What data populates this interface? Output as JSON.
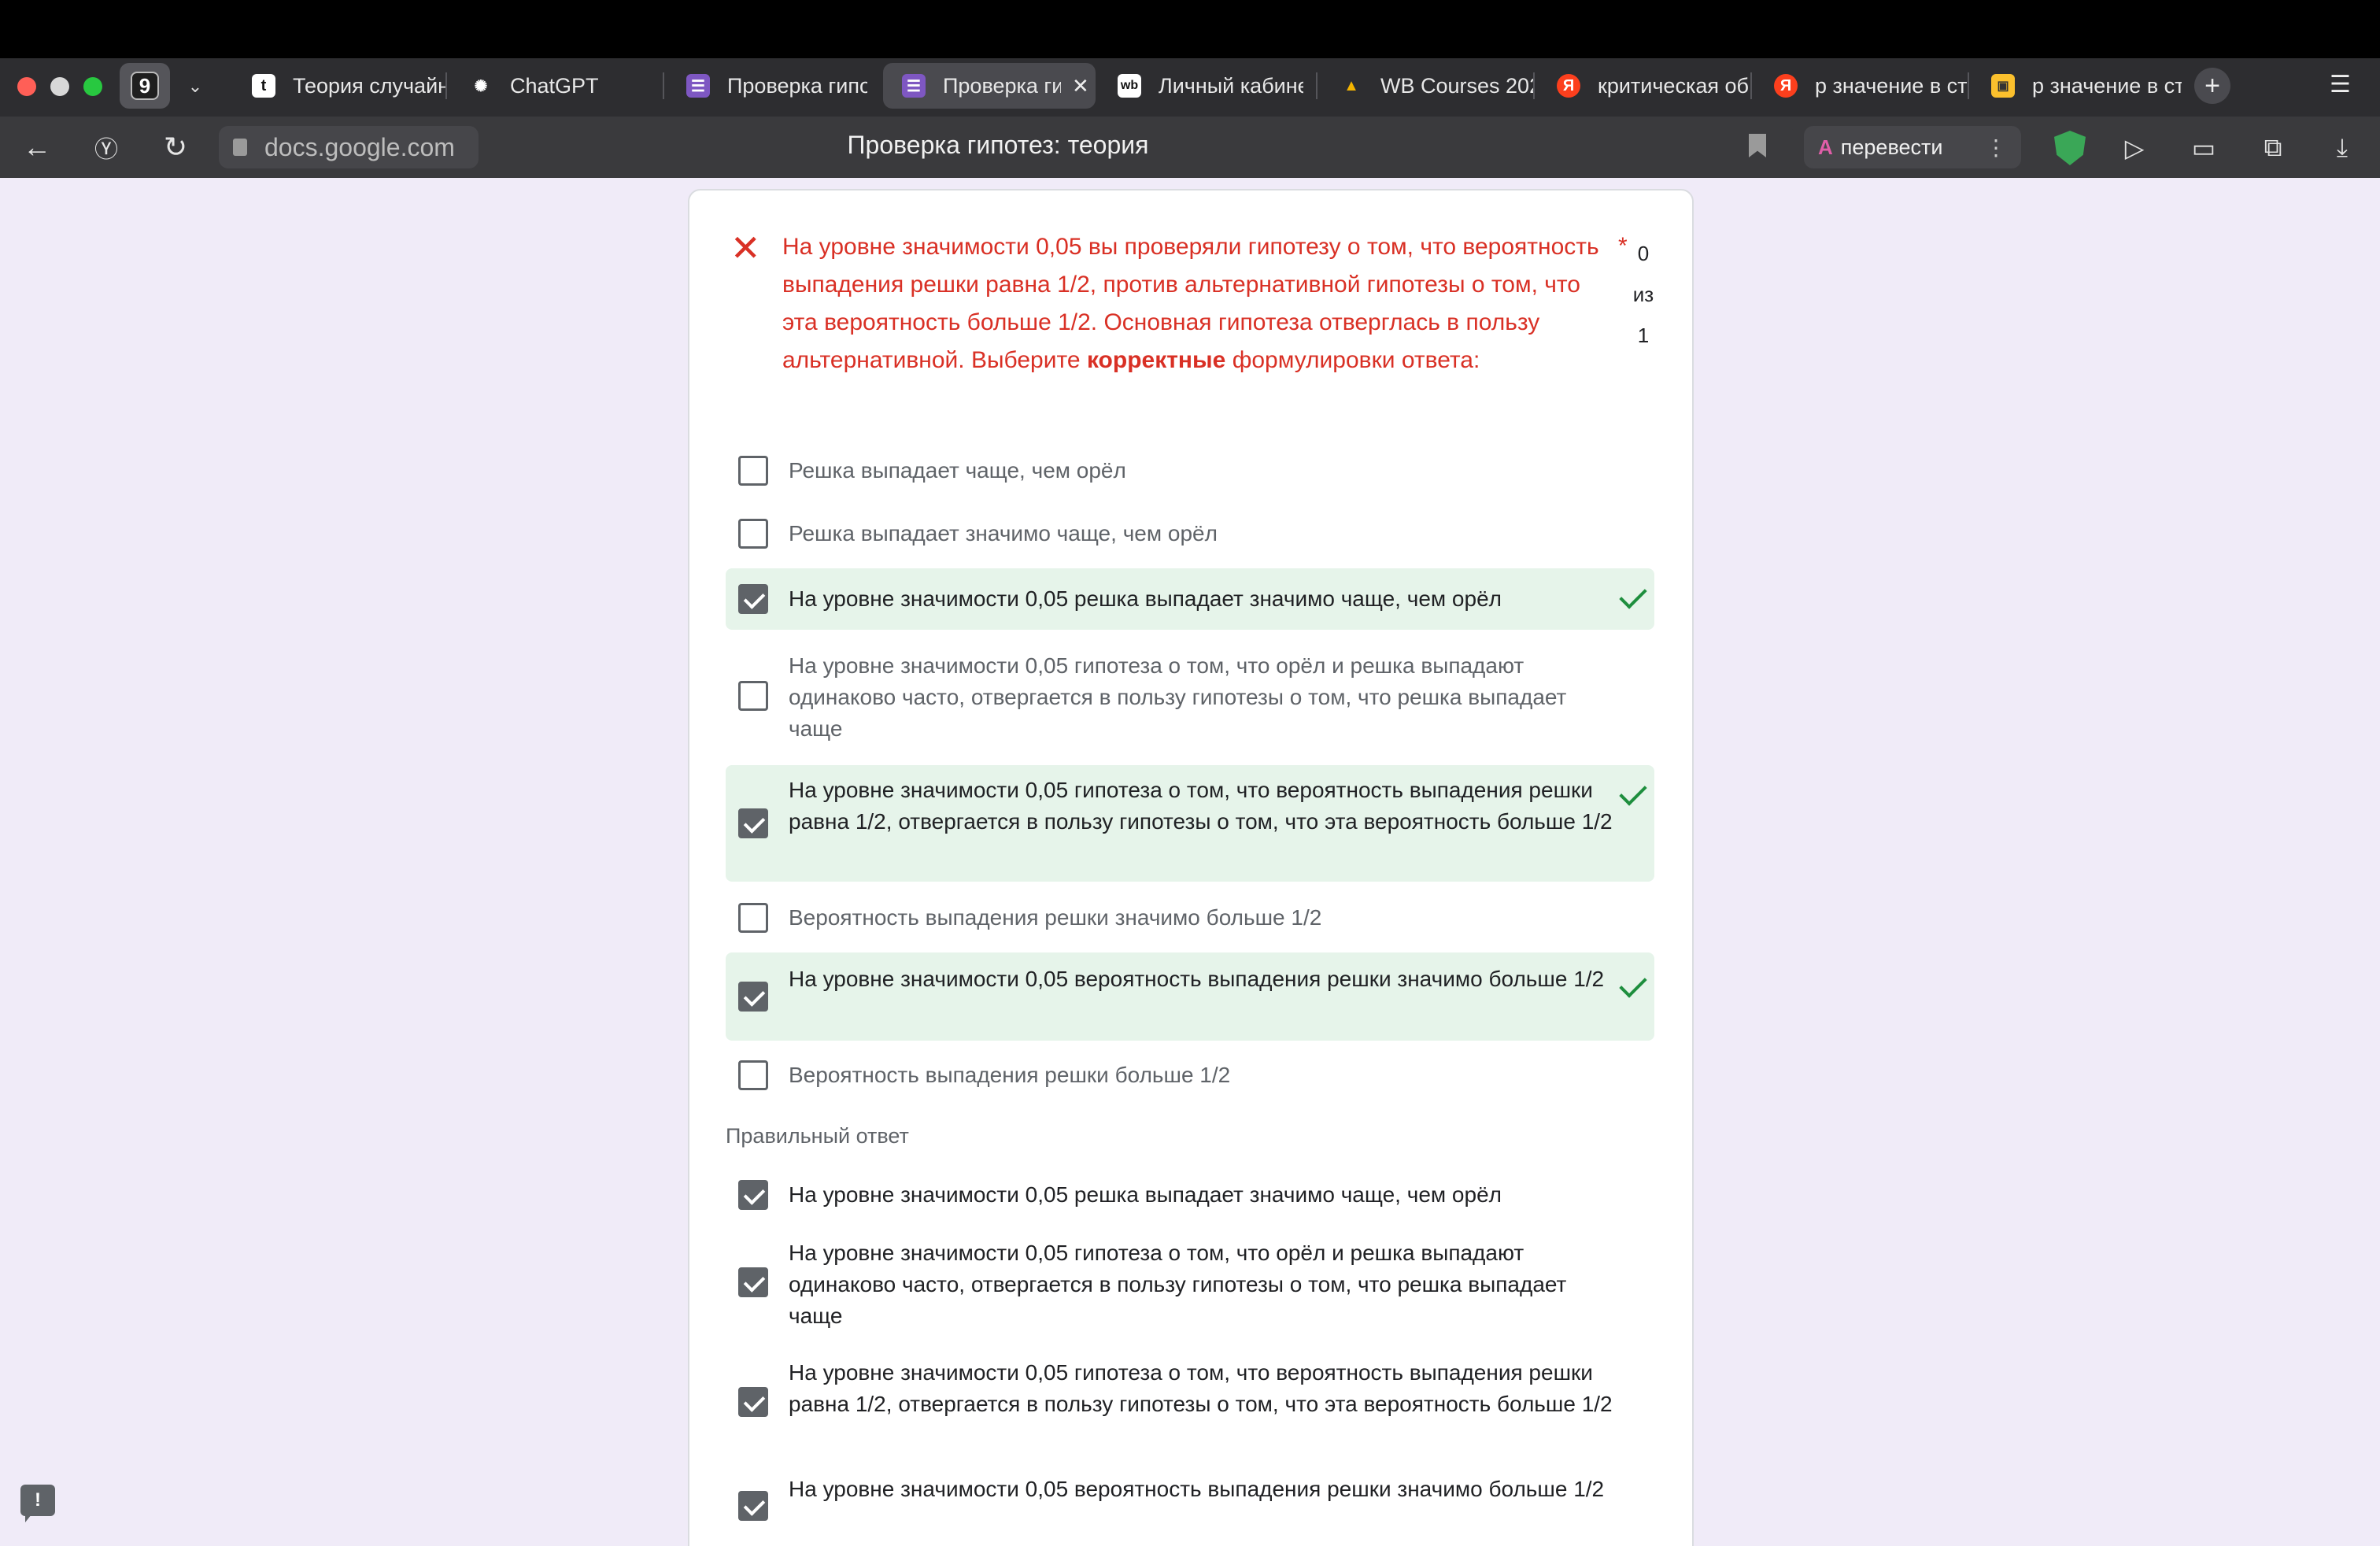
{
  "browser": {
    "tab_count": "9",
    "tabs": [
      {
        "label": "Теория случайн",
        "icon": "t"
      },
      {
        "label": "ChatGPT",
        "icon": "✺"
      },
      {
        "label": "Проверка гипо",
        "icon": "☰"
      },
      {
        "label": "Проверка ги",
        "icon": "☰",
        "active": true
      },
      {
        "label": "Личный кабине",
        "icon": "wb"
      },
      {
        "label": "WB Courses 202",
        "icon": "▲"
      },
      {
        "label": "критическая об",
        "icon": "Я"
      },
      {
        "label": "p значение в ст",
        "icon": "Я"
      },
      {
        "label": "p значение в ст",
        "icon": "▣"
      }
    ],
    "address": "docs.google.com",
    "page_title": "Проверка гипотез: теория",
    "translate_label": "перевести"
  },
  "question": {
    "text_before_bold": "На уровне значимости 0,05 вы проверяли гипотезу о том, что вероятность выпадения решки равна 1/2, против альтернативной гипотезы о том, что эта вероятность больше 1/2. Основная гипотеза отверглась в пользу альтернативной. Выберите ",
    "bold": "корректные",
    "text_after_bold": " формулировки ответа:",
    "required_mark": "*",
    "score_points": "0",
    "score_of": "из",
    "score_total": "1"
  },
  "options": [
    {
      "label": "Решка выпадает чаще, чем орёл",
      "checked": false,
      "correct": false
    },
    {
      "label": "Решка выпадает значимо чаще, чем орёл",
      "checked": false,
      "correct": false
    },
    {
      "label": "На уровне значимости 0,05 решка выпадает значимо чаще, чем орёл",
      "checked": true,
      "correct": true
    },
    {
      "label": "На уровне значимости 0,05 гипотеза о том, что орёл и решка выпадают одинаково часто, отвергается в пользу гипотезы о том, что решка выпадает чаще",
      "checked": false,
      "correct": false
    },
    {
      "label": "На уровне значимости 0,05 гипотеза о том, что вероятность выпадения решки равна 1/2, отвергается в пользу гипотезы о том, что эта вероятность больше 1/2",
      "checked": true,
      "correct": true
    },
    {
      "label": "Вероятность выпадения решки значимо больше 1/2",
      "checked": false,
      "correct": false
    },
    {
      "label": "На уровне значимости 0,05 вероятность выпадения решки значимо больше 1/2",
      "checked": true,
      "correct": true
    },
    {
      "label": "Вероятность выпадения решки больше 1/2",
      "checked": false,
      "correct": false
    }
  ],
  "correct_answer": {
    "header": "Правильный ответ",
    "items": [
      "На уровне значимости 0,05 решка выпадает значимо чаще, чем орёл",
      "На уровне значимости 0,05 гипотеза о том, что орёл и решка выпадают одинаково часто, отвергается в пользу гипотезы о том, что решка выпадает чаще",
      "На уровне значимости 0,05 гипотеза о том, что вероятность выпадения решки равна 1/2, отвергается в пользу гипотезы о том, что эта вероятность больше 1/2",
      "На уровне значимости 0,05 вероятность выпадения решки значимо больше 1/2"
    ]
  },
  "colors": {
    "error_red": "#d93025",
    "correct_bg": "#e6f4ea",
    "check_green": "#1e8e3e",
    "page_bg": "#f0ebf8"
  }
}
